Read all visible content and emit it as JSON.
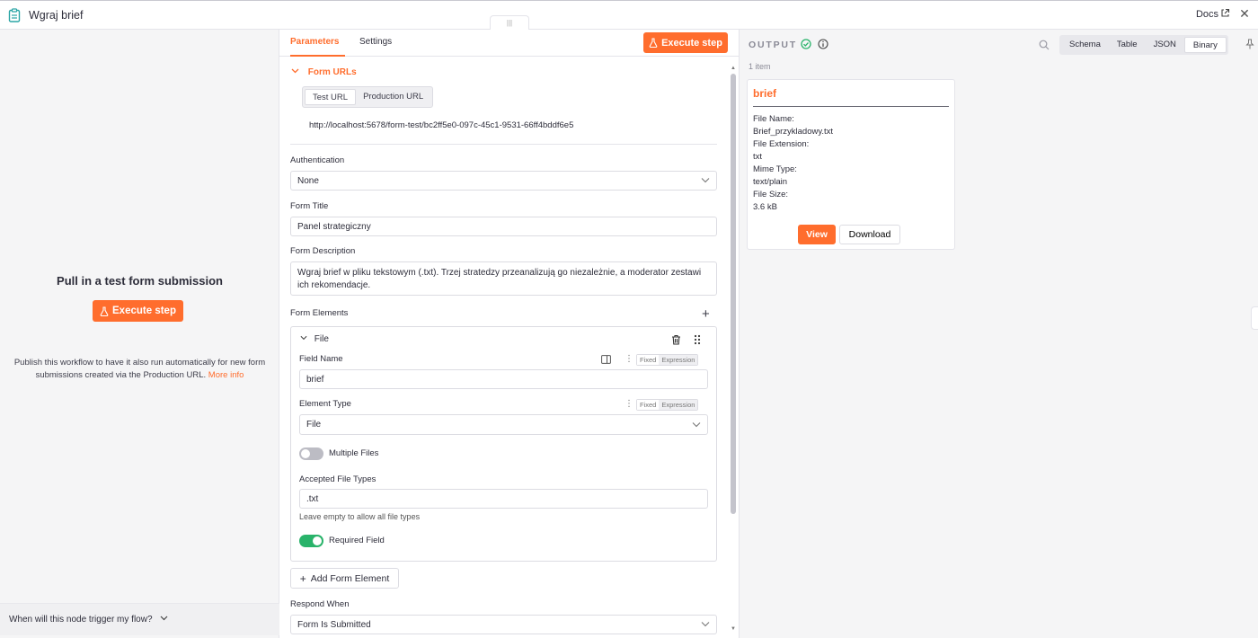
{
  "header": {
    "title": "Wgraj brief",
    "docs_label": "Docs"
  },
  "left_panel": {
    "heading": "Pull in a test form submission",
    "execute_label": "Execute step",
    "publish_text": "Publish this workflow to have it also run automatically for new form submissions created via the Production URL.",
    "more_info": "More info",
    "when_trigger": "When will this node trigger my flow?"
  },
  "params": {
    "tabs": [
      "Parameters",
      "Settings"
    ],
    "execute_label": "Execute step",
    "form_urls": {
      "section_label": "Form URLs",
      "tabs": [
        "Test URL",
        "Production URL"
      ],
      "url": "http://localhost:5678/form-test/bc2ff5e0-097c-45c1-9531-66ff4bddf6e5"
    },
    "authentication": {
      "label": "Authentication",
      "value": "None"
    },
    "form_title": {
      "label": "Form Title",
      "value": "Panel strategiczny"
    },
    "form_description": {
      "label": "Form Description",
      "value": "Wgraj brief w pliku tekstowym (.txt). Trzej stratedzy przeanalizują go niezależnie, a moderator zestawi ich rekomendacje."
    },
    "form_elements": {
      "label": "Form Elements",
      "element": {
        "title": "File",
        "field_name_label": "Field Name",
        "field_name_value": "brief",
        "element_type_label": "Element Type",
        "element_type_value": "File",
        "multiple_files_label": "Multiple Files",
        "multiple_files_on": false,
        "accepted_types_label": "Accepted File Types",
        "accepted_types_value": ".txt",
        "accepted_types_hint": "Leave empty to allow all file types",
        "required_label": "Required Field",
        "required_on": true
      },
      "fixed_label": "Fixed",
      "expression_label": "Expression",
      "add_label": "Add Form Element"
    },
    "respond_when": {
      "label": "Respond When",
      "value": "Form Is Submitted"
    }
  },
  "output": {
    "label": "OUTPUT",
    "item_count": "1 item",
    "view_tabs": [
      "Schema",
      "Table",
      "JSON",
      "Binary"
    ],
    "active_view": "Binary",
    "card": {
      "name": "brief",
      "file_name_label": "File Name:",
      "file_name": "Brief_przykladowy.txt",
      "ext_label": "File Extension:",
      "ext": "txt",
      "mime_label": "Mime Type:",
      "mime": "text/plain",
      "size_label": "File Size:",
      "size": "3.6 kB",
      "view_label": "View",
      "download_label": "Download"
    }
  },
  "colors": {
    "accent": "#ff6d2d",
    "success": "#29b36a",
    "node_icon": "#2aa5a5"
  }
}
